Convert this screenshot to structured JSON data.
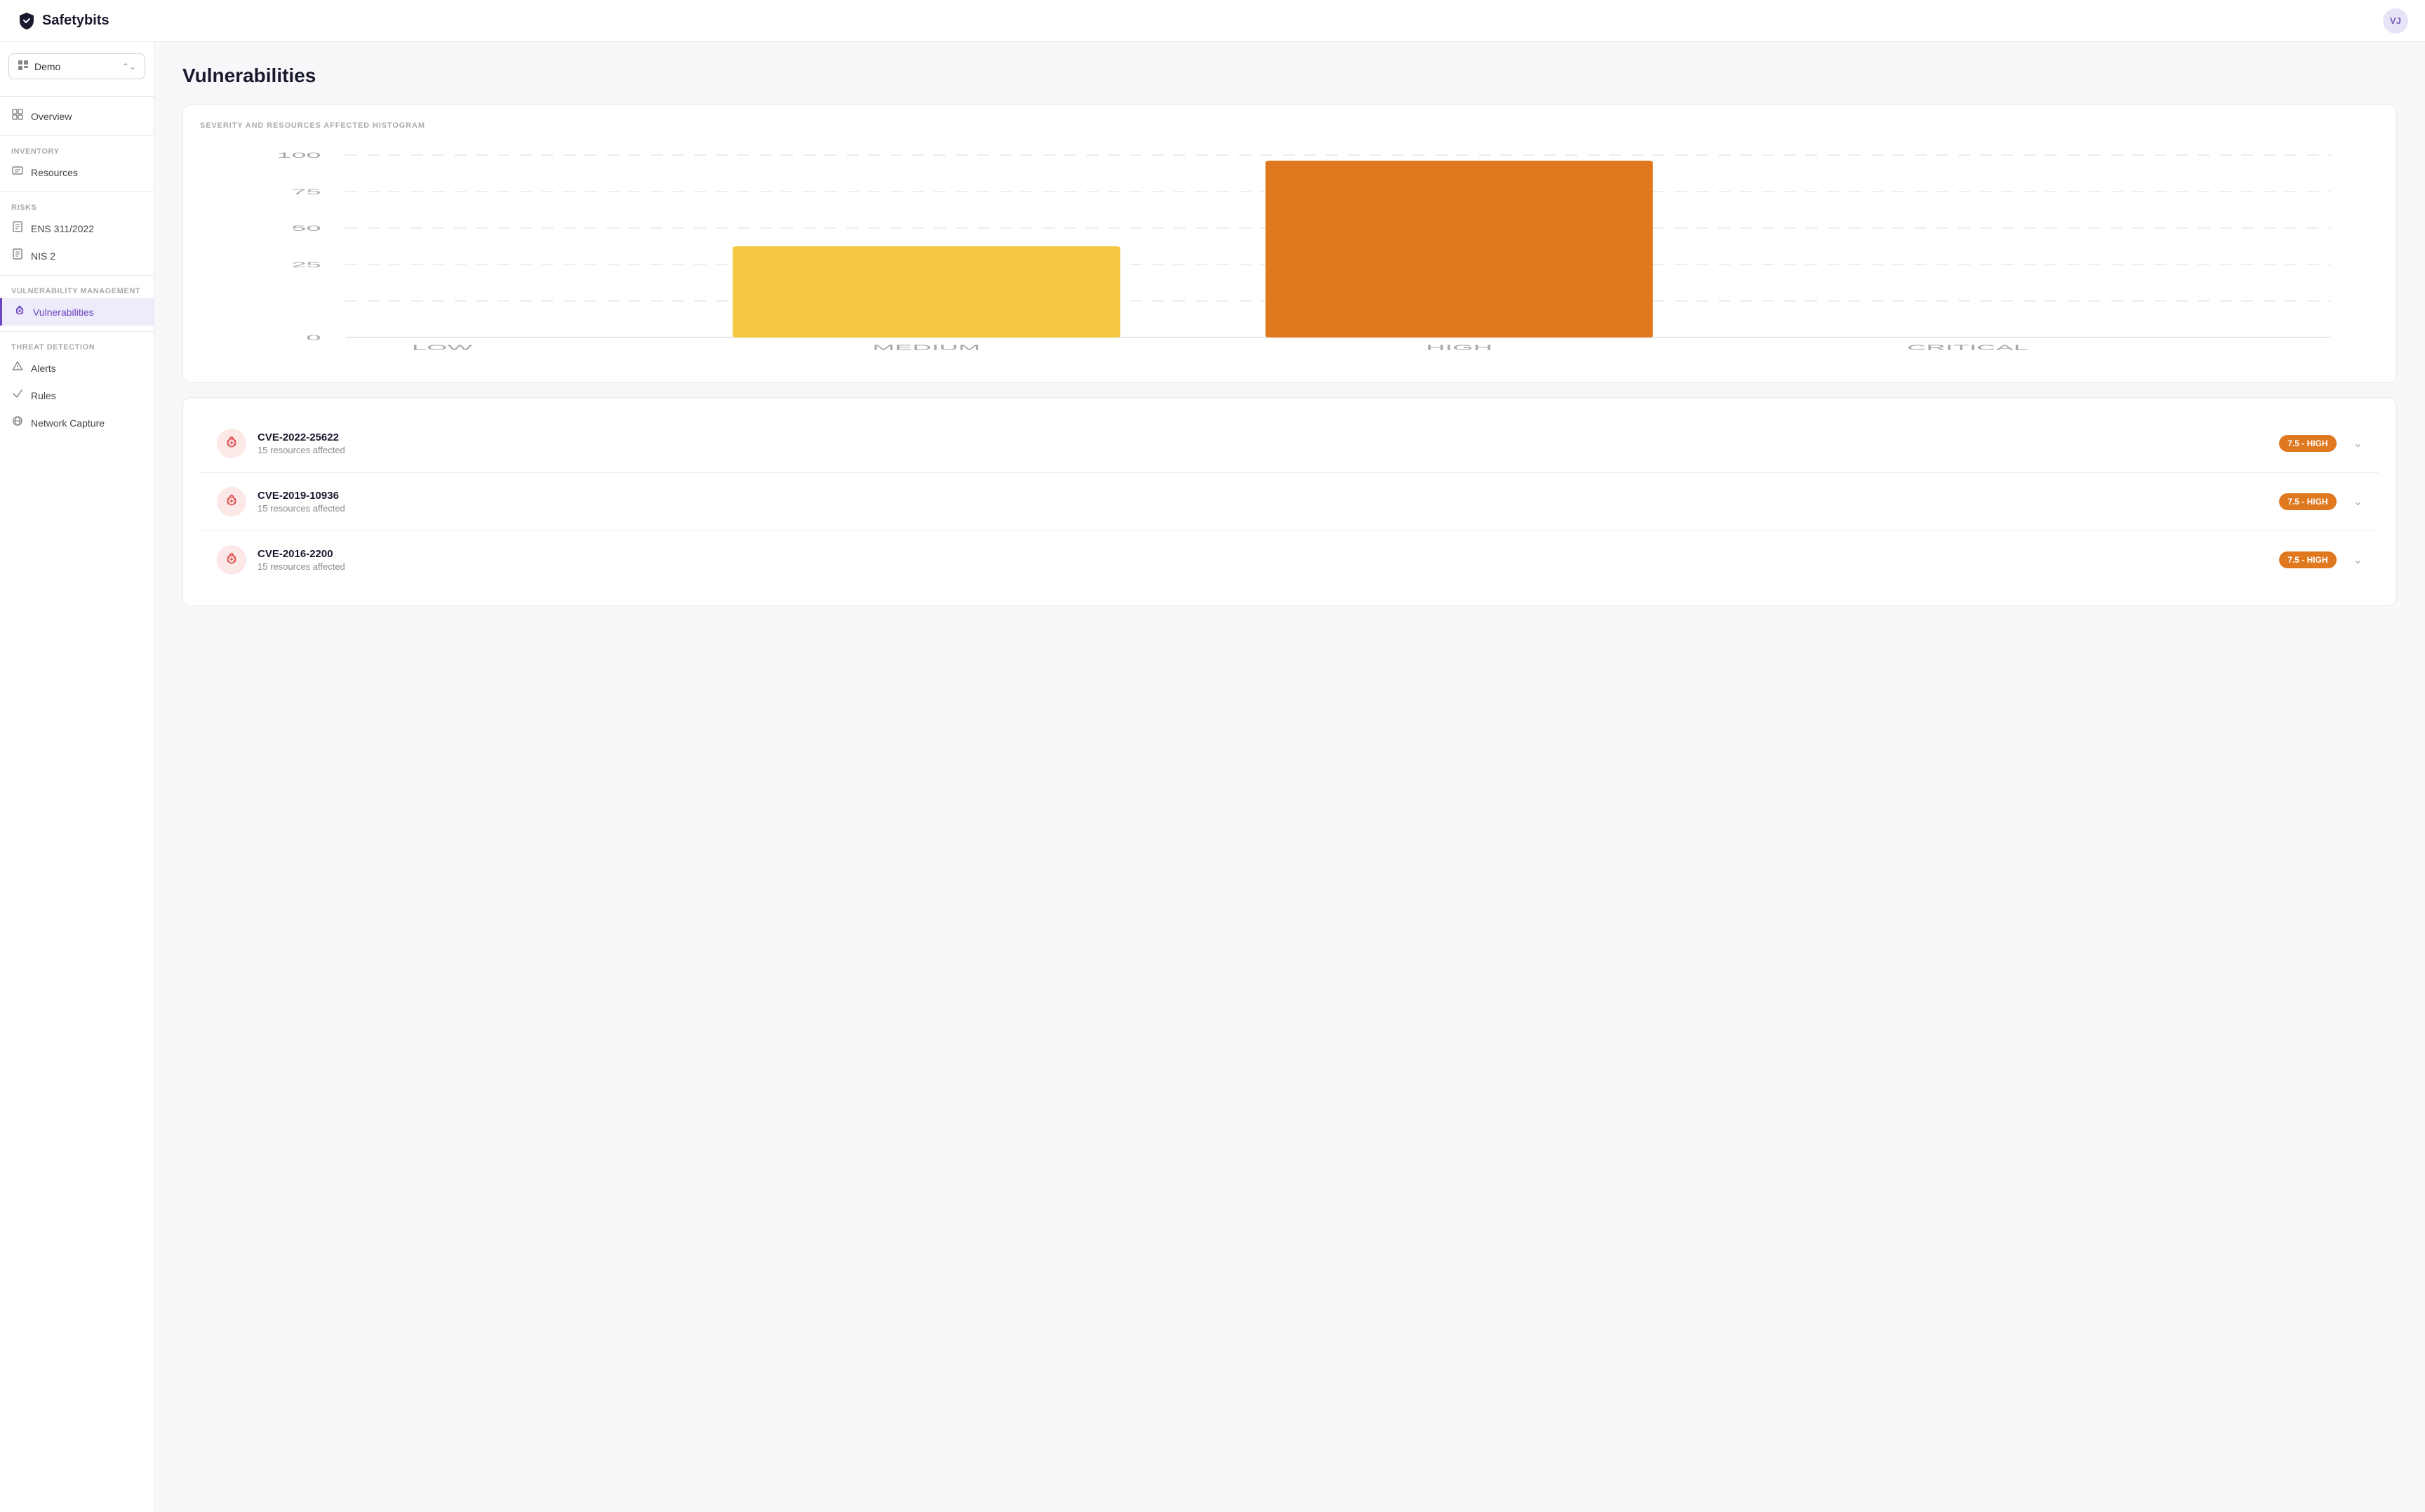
{
  "header": {
    "title": "Safetybits",
    "avatar_initials": "VJ"
  },
  "workspace": {
    "label": "Demo",
    "icon": "📊"
  },
  "sidebar": {
    "sections": [
      {
        "items": [
          {
            "id": "overview",
            "label": "Overview",
            "icon": "overview"
          }
        ]
      },
      {
        "section_label": "INVENTORY",
        "items": [
          {
            "id": "resources",
            "label": "Resources",
            "icon": "resources"
          }
        ]
      },
      {
        "section_label": "RISKS",
        "items": [
          {
            "id": "ens",
            "label": "ENS 311/2022",
            "icon": "ens"
          },
          {
            "id": "nis2",
            "label": "NIS 2",
            "icon": "nis"
          }
        ]
      },
      {
        "section_label": "VULNERABILITY MANAGEMENT",
        "items": [
          {
            "id": "vulnerabilities",
            "label": "Vulnerabilities",
            "icon": "bug",
            "active": true
          }
        ]
      },
      {
        "section_label": "THREAT DETECTION",
        "items": [
          {
            "id": "alerts",
            "label": "Alerts",
            "icon": "alerts"
          },
          {
            "id": "rules",
            "label": "Rules",
            "icon": "rules"
          },
          {
            "id": "network-capture",
            "label": "Network Capture",
            "icon": "network"
          }
        ]
      }
    ]
  },
  "page": {
    "title": "Vulnerabilities"
  },
  "chart": {
    "title": "SEVERITY AND RESOURCES AFFECTED HISTOGRAM",
    "y_labels": [
      "100",
      "75",
      "50",
      "25",
      "0"
    ],
    "bars": [
      {
        "label": "LOW",
        "value": 0,
        "color": "#f5c842"
      },
      {
        "label": "MEDIUM",
        "value": 50,
        "color": "#f5c842"
      },
      {
        "label": "HIGH",
        "value": 97,
        "color": "#e07820"
      },
      {
        "label": "CRITICAL",
        "value": 0,
        "color": "#e03030"
      }
    ],
    "max": 100
  },
  "vulnerabilities": [
    {
      "id": "CVE-2022-25622",
      "resources": "15 resources affected",
      "score": "7.5 - HIGH",
      "badge_color": "#e07820"
    },
    {
      "id": "CVE-2019-10936",
      "resources": "15 resources affected",
      "score": "7.5 - HIGH",
      "badge_color": "#e07820"
    },
    {
      "id": "CVE-2016-2200",
      "resources": "15 resources affected",
      "score": "7.5 - HIGH",
      "badge_color": "#e07820"
    }
  ]
}
